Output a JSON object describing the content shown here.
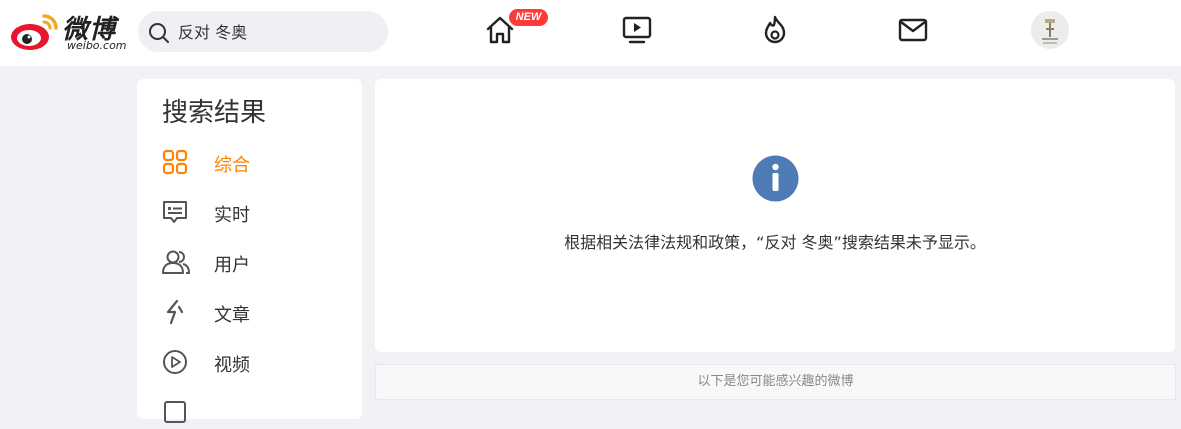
{
  "header": {
    "logo_cn": "微博",
    "logo_en": "weibo.com",
    "search": {
      "value": "反对 冬奥",
      "icon": "search-icon"
    },
    "nav": [
      {
        "name": "home",
        "icon": "home-icon",
        "badge": "NEW"
      },
      {
        "name": "video",
        "icon": "video-icon"
      },
      {
        "name": "hot",
        "icon": "flame-icon"
      },
      {
        "name": "messages",
        "icon": "mail-icon"
      }
    ],
    "avatar": "avatar"
  },
  "sidebar": {
    "title": "搜索结果",
    "items": [
      {
        "label": "综合",
        "icon": "grid-icon",
        "active": true
      },
      {
        "label": "实时",
        "icon": "message-icon"
      },
      {
        "label": "用户",
        "icon": "users-icon"
      },
      {
        "label": "文章",
        "icon": "lightning-icon"
      },
      {
        "label": "视频",
        "icon": "play-circle-icon"
      }
    ]
  },
  "main": {
    "notice": "根据相关法律法规和政策，“反对 冬奥”搜索结果未予显示。",
    "recommend": "以下是您可能感兴趣的微博"
  },
  "colors": {
    "accent": "#ff8200",
    "badge": "#ff3a3a",
    "info": "#4e7bb5",
    "background": "#f1f2f5"
  }
}
